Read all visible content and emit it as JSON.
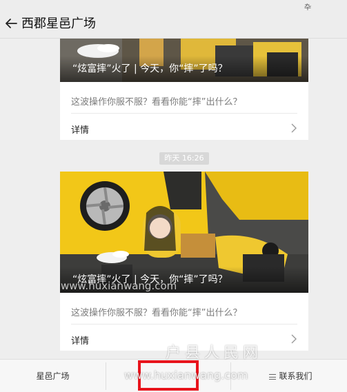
{
  "header": {
    "title": "西郡星邑广场"
  },
  "cards": [
    {
      "caption": "“炫富摔”火了 | 今天，你“摔”了吗？",
      "summary": "这波操作你服不服？看看你能“摔”出什么？",
      "detail_label": "详情"
    },
    {
      "caption": "“炫富摔”火了 | 今天，你“摔”了吗？",
      "summary": "这波操作你服不服？看看你能“摔”出什么？",
      "detail_label": "详情"
    }
  ],
  "timestamp": "昨天 16:26",
  "tabbar": {
    "tabs": [
      {
        "label": "星邑广场"
      },
      {
        "label": ""
      },
      {
        "label": "联系我们"
      }
    ]
  },
  "watermarks": {
    "site_url_1": "www.huxianwang.com",
    "site_name": "户县人民网",
    "site_url_2": "www.huxianwang.com"
  },
  "colors": {
    "highlight": "#e8141c",
    "car_yellow": "#f2c718",
    "dress_yellow": "#efc830"
  },
  "icons": [
    "back-arrow-icon",
    "chevron-right-icon",
    "menu-icon",
    "status-icon"
  ]
}
